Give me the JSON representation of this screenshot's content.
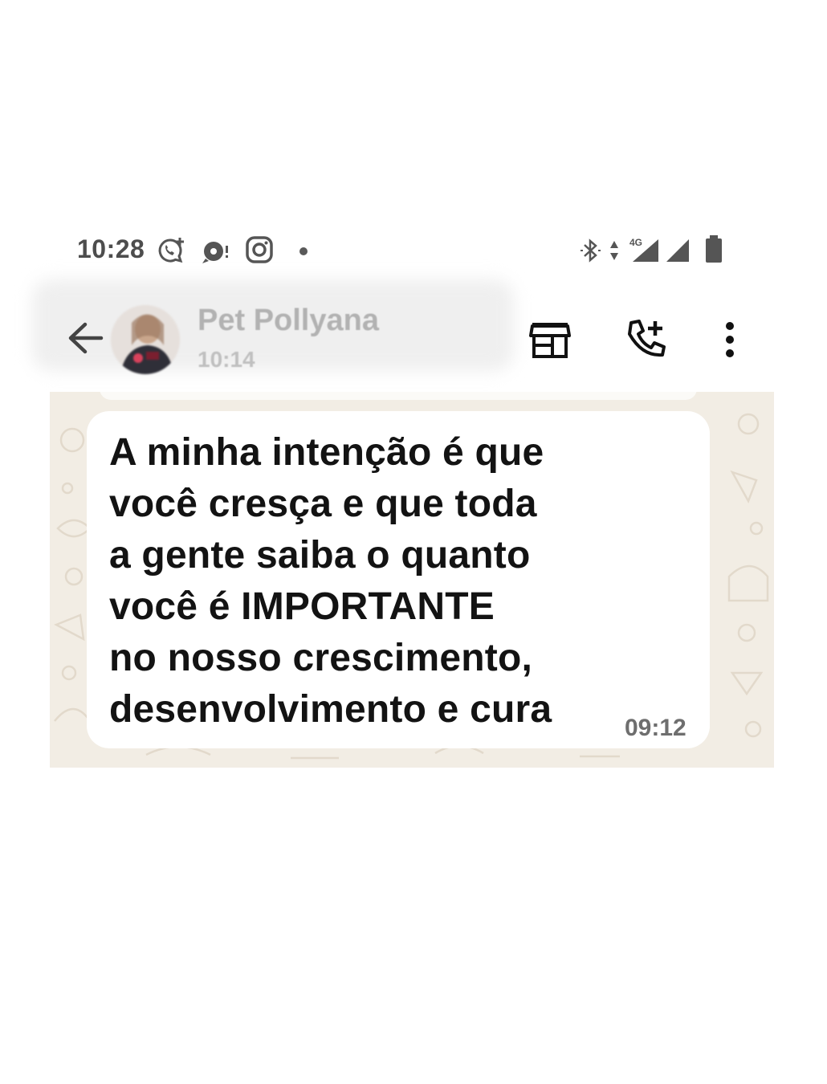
{
  "status_bar": {
    "time": "10:28",
    "network_label": "4G",
    "icons": [
      "whatsapp-notification-icon",
      "chat-notification-icon",
      "instagram-icon",
      "more-notifications-dot-icon",
      "bluetooth-icon",
      "data-activity-icon",
      "mobile-signal-icon",
      "signal-icon",
      "battery-icon"
    ]
  },
  "chat_header": {
    "contact_name": "Pet Pollyana",
    "last_seen": "10:14",
    "icons": [
      "back-arrow-icon",
      "avatar",
      "business-store-icon",
      "add-call-icon",
      "more-options-icon"
    ]
  },
  "message": {
    "lines": [
      "A minha intenção é que",
      "você cresça e que toda",
      "a gente saiba o quanto",
      "você é IMPORTANTE",
      "no nosso crescimento,",
      "desenvolvimento e cura"
    ],
    "time": "09:12"
  },
  "colors": {
    "chat_background": "#f2ede4",
    "bubble": "#ffffff",
    "message_text": "#131313",
    "header_icons": "#111111",
    "status_text": "#4d4d4d"
  }
}
